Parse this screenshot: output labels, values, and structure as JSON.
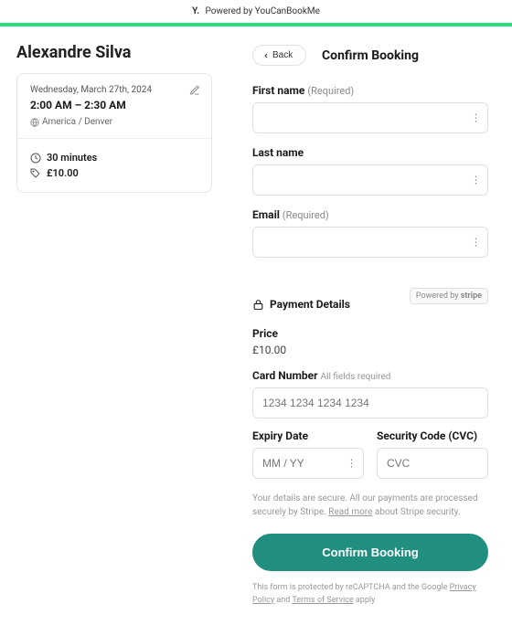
{
  "topbar": {
    "powered": "Powered by YouCanBookMe"
  },
  "host": {
    "name": "Alexandre Silva"
  },
  "booking": {
    "date": "Wednesday, March 27th, 2024",
    "time": "2:00 AM – 2:30 AM",
    "timezone": "America / Denver",
    "duration": "30 minutes",
    "price": "£10.00"
  },
  "nav": {
    "back": "Back",
    "title": "Confirm Booking"
  },
  "form": {
    "first_name_label": "First name",
    "last_name_label": "Last name",
    "email_label": "Email",
    "required": "(Required)"
  },
  "payment": {
    "title": "Payment Details",
    "stripe_badge_prefix": "Powered by ",
    "stripe_badge_brand": "stripe",
    "price_label": "Price",
    "price_value": "£10.00",
    "card_label": "Card Number",
    "card_hint": "All fields required",
    "card_placeholder": "1234 1234 1234 1234",
    "expiry_label": "Expiry Date",
    "expiry_placeholder": "MM / YY",
    "cvc_label": "Security Code (CVC)",
    "cvc_placeholder": "CVC",
    "secure_prefix": "Your details are secure. All our payments are processed securely by Stripe. ",
    "secure_link": "Read more",
    "secure_suffix": " about Stripe security."
  },
  "cta": {
    "confirm": "Confirm Booking"
  },
  "legal": {
    "prefix": "This form is protected by reCAPTCHA and the Google ",
    "privacy": "Privacy Policy",
    "mid": " and ",
    "tos": "Terms of Service",
    "suffix": " apply"
  }
}
